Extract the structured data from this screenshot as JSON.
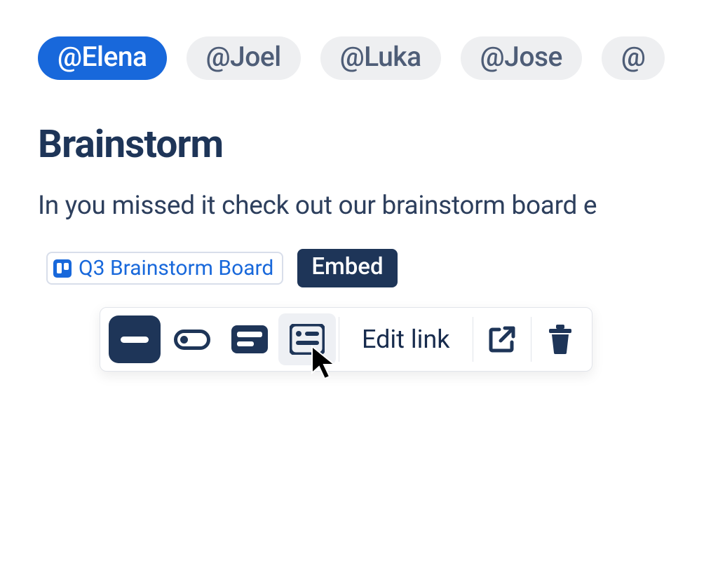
{
  "mentions": {
    "items": [
      {
        "label": "@Elena",
        "selected": true
      },
      {
        "label": "@Joel",
        "selected": false
      },
      {
        "label": "@Luka",
        "selected": false
      },
      {
        "label": "@Jose",
        "selected": false
      },
      {
        "label": "@",
        "selected": false
      }
    ]
  },
  "heading": "Brainstorm",
  "body": "In you missed it check out our brainstorm board e",
  "smart_link": {
    "icon": "trello-icon",
    "label": "Q3 Brainstorm Board"
  },
  "tooltip": "Embed",
  "toolbar": {
    "url_view": "url-view-icon",
    "inline_view": "inline-view-icon",
    "card_view": "card-view-icon",
    "embed_view": "embed-view-icon",
    "edit_link_label": "Edit link",
    "open_label": "open-external-icon",
    "delete_label": "trash-icon"
  },
  "colors": {
    "accent": "#1868db",
    "dark": "#1e3558",
    "chip_bg": "#eeeff1"
  }
}
